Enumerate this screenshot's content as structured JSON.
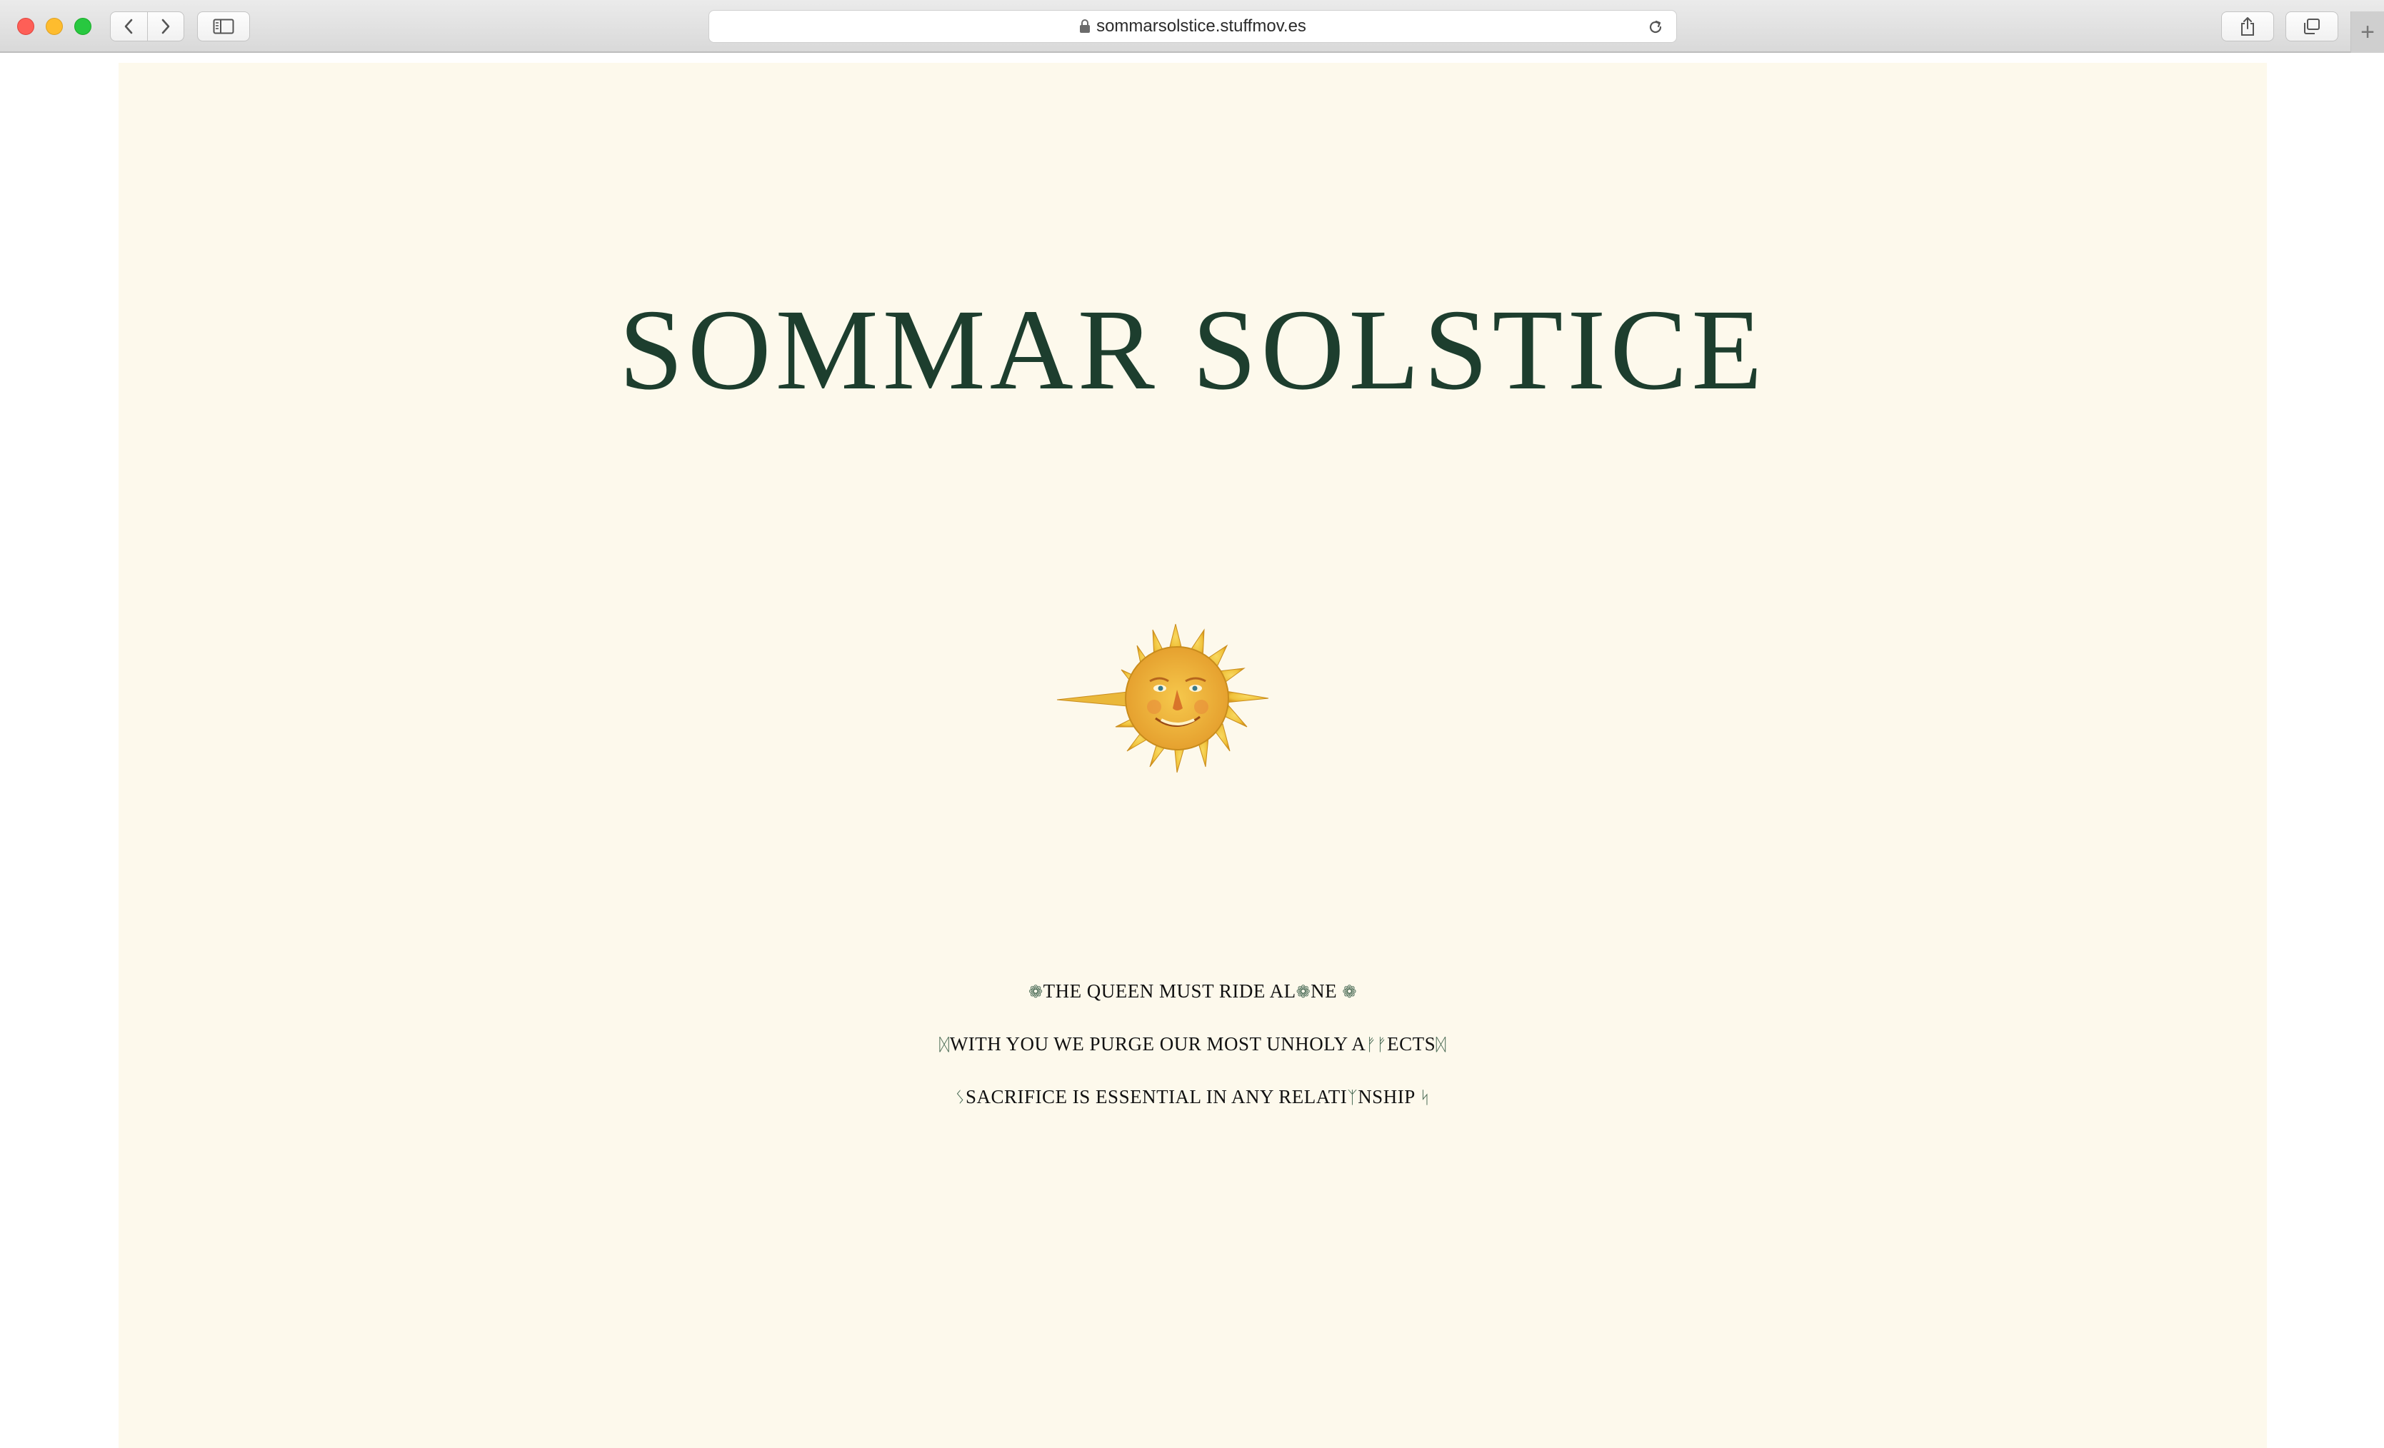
{
  "browser": {
    "url": "sommarsolstice.stuffmov.es",
    "new_tab_label": "+"
  },
  "page": {
    "title": "SOMMAR SOLSTICE",
    "quotes": [
      {
        "pre": "❁",
        "text": "THE QUEEN MUST RIDE AL",
        "mid": "❁",
        "post_text": "NE",
        "end": "❁"
      },
      {
        "pre": "ᛞ",
        "text": "WITH YOU WE PURGE OUR MOST UNHOLY A",
        "mid": "ᚠᚠ",
        "post_text": "ECTS",
        "end": "ᛞ"
      },
      {
        "pre": "ᛊ",
        "text": "SACRIFICE IS ESSENTIAL IN ANY RELATI",
        "mid": "ᛉ",
        "post_text": "NSHIP",
        "end": "ᛋ"
      }
    ]
  },
  "colors": {
    "page_background": "#fdf9ec",
    "title": "#1d3e2e",
    "sun": "#f2c53a"
  }
}
